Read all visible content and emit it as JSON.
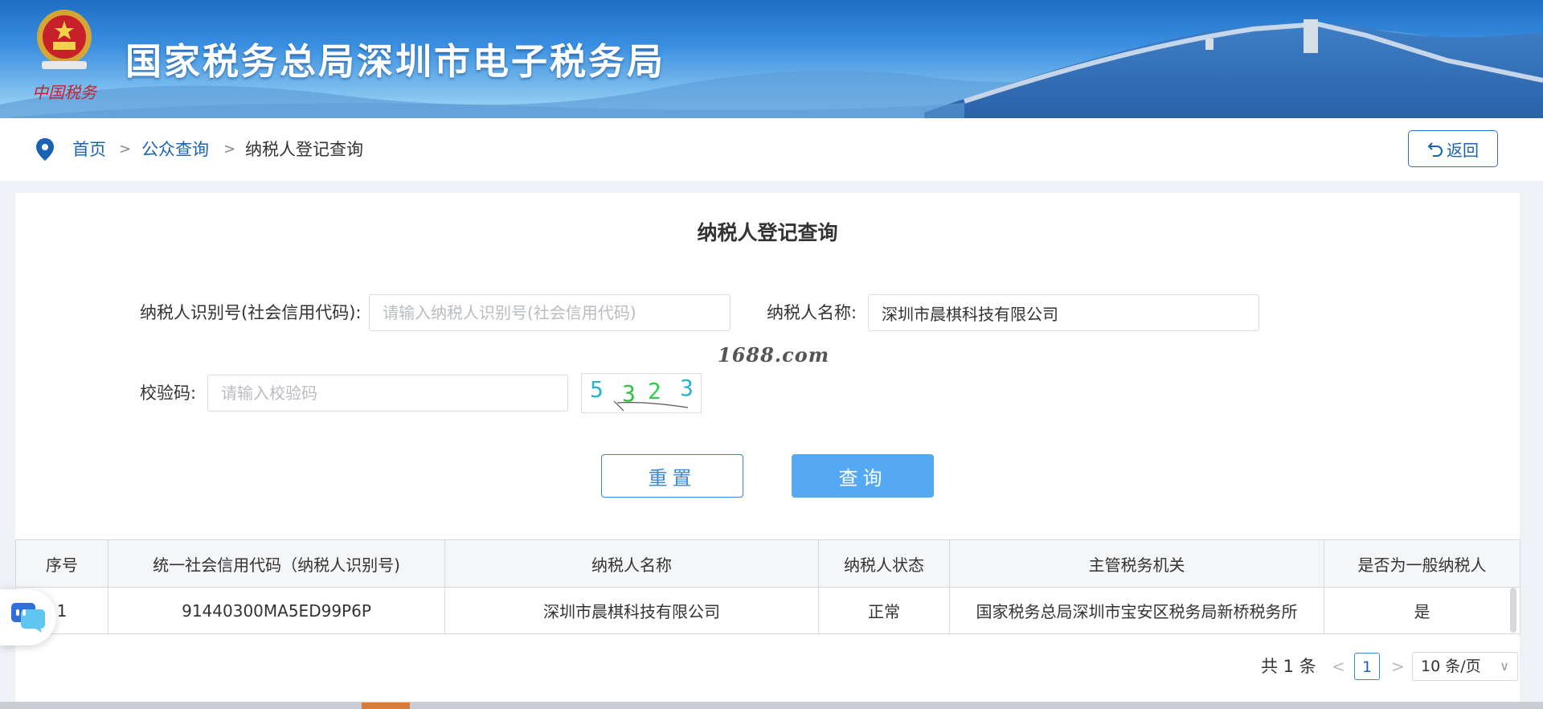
{
  "header": {
    "title": "国家税务总局深圳市电子税务局",
    "emblem_text": "中国税务"
  },
  "breadcrumb": {
    "home": "首页",
    "separator": ">",
    "public_query": "公众查询",
    "current": "纳税人登记查询"
  },
  "back_button": {
    "icon": "return-arrow-icon",
    "label": "返回"
  },
  "form": {
    "title": "纳税人登记查询",
    "taxpayer_id": {
      "label": "纳税人识别号(社会信用代码):",
      "value": "",
      "placeholder": "请输入纳税人识别号(社会信用代码)"
    },
    "taxpayer_name": {
      "label": "纳税人名称:",
      "value": "深圳市晨棋科技有限公司",
      "placeholder": ""
    },
    "captcha": {
      "label": "校验码:",
      "value": "",
      "placeholder": "请输入校验码",
      "image_chars": [
        "5",
        "3",
        "2",
        "3"
      ]
    },
    "reset_label": "重置",
    "query_label": "查询"
  },
  "watermark": "1688.com",
  "table": {
    "columns": [
      "序号",
      "统一社会信用代码（纳税人识别号)",
      "纳税人名称",
      "纳税人状态",
      "主管税务机关",
      "是否为一般纳税人"
    ],
    "rows": [
      [
        "1",
        "91440300MA5ED99P6P",
        "深圳市晨棋科技有限公司",
        "正常",
        "国家税务总局深圳市宝安区税务局新桥税务所",
        "是"
      ]
    ]
  },
  "pagination": {
    "total": "共 1 条",
    "prev": "<",
    "current_page": "1",
    "next": ">",
    "page_size": "10 条/页"
  },
  "colors": {
    "link": "#1a63b3",
    "primary_button": "#55a8f2",
    "banner_top": "#1d6ec4"
  }
}
